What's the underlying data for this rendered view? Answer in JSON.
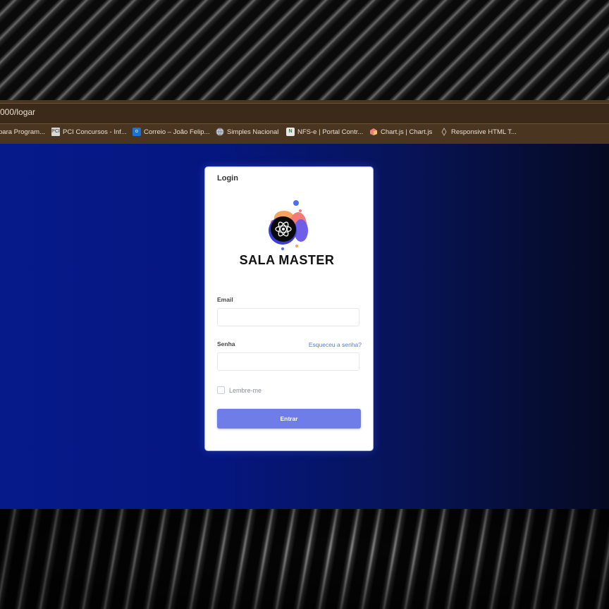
{
  "browser": {
    "address": "000/logar",
    "bookmarks": [
      {
        "label": "para Program...",
        "icon": "bookmark-icon"
      },
      {
        "label": "PCI Concursos - Inf...",
        "icon": "pci-icon",
        "icon_text": "PCI"
      },
      {
        "label": "Correio – João Felip...",
        "icon": "outlook-icon",
        "icon_text": "o"
      },
      {
        "label": "Simples Nacional",
        "icon": "globe-icon"
      },
      {
        "label": "NFS-e | Portal Contr...",
        "icon": "nfse-icon"
      },
      {
        "label": "Chart.js | Chart.js",
        "icon": "chartjs-icon"
      },
      {
        "label": "Responsive HTML T...",
        "icon": "template-icon"
      }
    ]
  },
  "login": {
    "title": "Login",
    "brand": "SALA MASTER",
    "email_label": "Email",
    "email_value": "",
    "password_label": "Senha",
    "password_value": "",
    "forgot_link": "Esqueceu a senha?",
    "remember_label": "Lembre-me",
    "remember_checked": false,
    "submit_label": "Entrar"
  },
  "colors": {
    "accent": "#6f7de8",
    "link": "#5b7bd6",
    "page_bg_left": "#061a8a",
    "page_bg_right": "#050a22",
    "browser_chrome": "#4a3521"
  }
}
